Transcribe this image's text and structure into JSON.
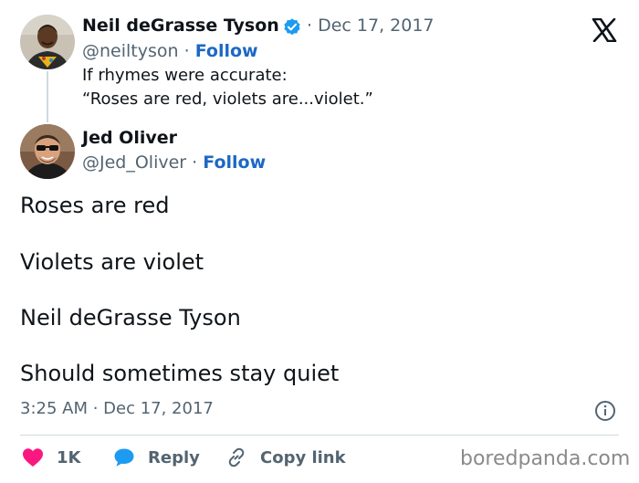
{
  "original_tweet": {
    "author_name": "Neil deGrasse Tyson",
    "verified": true,
    "date": "Dec 17, 2017",
    "handle": "@neiltyson",
    "separator": "·",
    "follow_label": "Follow",
    "text_lines": [
      "If rhymes were accurate:",
      "“Roses are red, violets are...violet.”"
    ]
  },
  "reply_tweet": {
    "author_name": "Jed Oliver",
    "handle": "@Jed_Oliver",
    "separator": "·",
    "follow_label": "Follow",
    "body_lines": [
      "Roses are red",
      "Violets are violet",
      "Neil deGrasse Tyson",
      "Should sometimes stay quiet"
    ],
    "timestamp": "3:25 AM · Dec 17, 2017"
  },
  "actions": {
    "likes_count": "1K",
    "reply_label": "Reply",
    "copy_link_label": "Copy link"
  },
  "watermark": "boredpanda.com",
  "colors": {
    "follow": "#1d68c4",
    "verified": "#1d9bf0",
    "like": "#f91880",
    "reply_icon": "#1d9bf0",
    "muted": "#536471"
  },
  "icons": {
    "platform_logo": "x-logo-icon",
    "verified": "verified-badge-icon",
    "info": "info-icon",
    "like": "heart-icon",
    "reply": "speech-bubble-icon",
    "copy_link": "link-icon"
  }
}
